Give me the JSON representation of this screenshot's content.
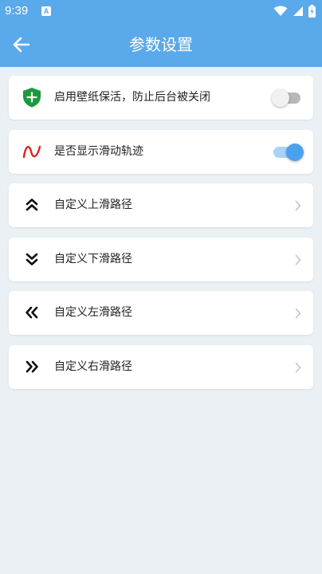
{
  "status_bar": {
    "time": "9:39",
    "app_icon_letter": "A"
  },
  "header": {
    "title": "参数设置",
    "back_icon": "arrow-left-icon"
  },
  "settings": [
    {
      "label": "启用壁纸保活，防止后台被关闭",
      "icon": "shield-plus-icon",
      "toggle": false,
      "accent": "#1a9a3c"
    },
    {
      "label": "是否显示滑动轨迹",
      "icon": "wave-icon",
      "toggle": true,
      "accent": "#e02020"
    },
    {
      "label": "自定义上滑路径",
      "icon": "double-chevron-up-icon"
    },
    {
      "label": "自定义下滑路径",
      "icon": "double-chevron-down-icon"
    },
    {
      "label": "自定义左滑路径",
      "icon": "double-chevron-left-icon"
    },
    {
      "label": "自定义右滑路径",
      "icon": "double-chevron-right-icon"
    }
  ],
  "colors": {
    "app_bar": "#5aa9ea",
    "background": "#eaf0f4",
    "toggle_on": "#4ba1ee"
  }
}
